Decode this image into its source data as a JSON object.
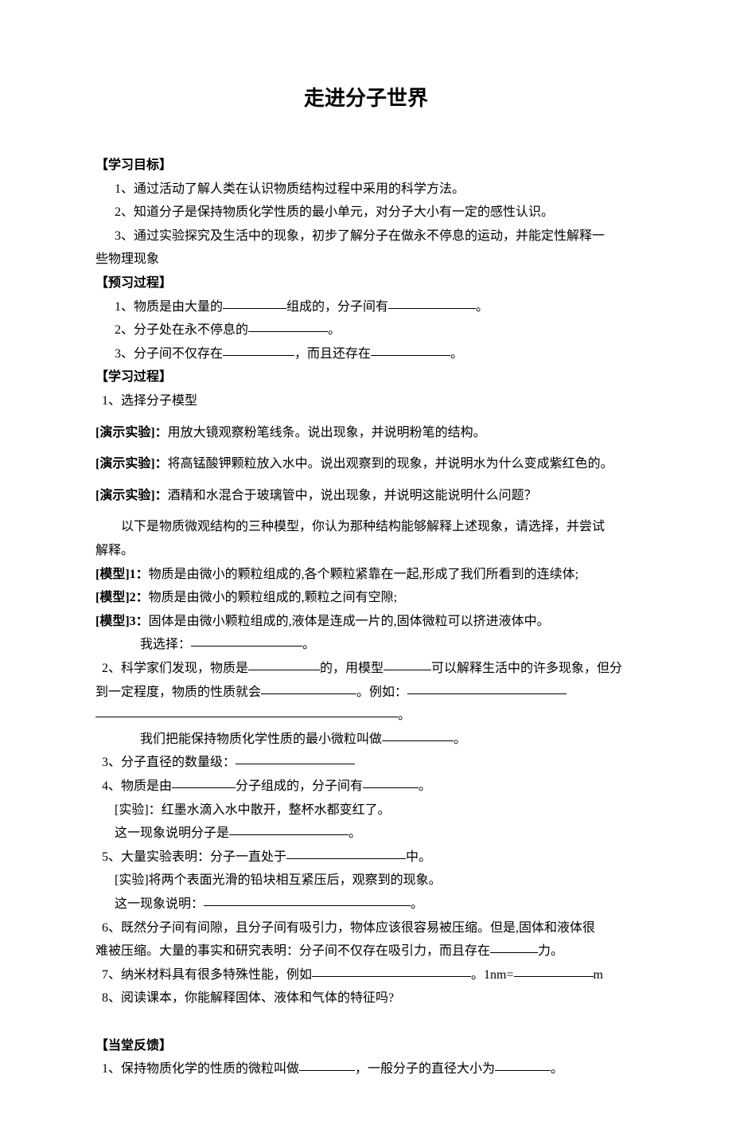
{
  "title": "走进分子世界",
  "s1": {
    "head": "【学习目标】",
    "i1": "1、通过活动了解人类在认识物质结构过程中采用的科学方法。",
    "i2": "2、知道分子是保持物质化学性质的最小单元，对分子大小有一定的感性认识。",
    "i3_a": "3、通过实验探究及生活中的现象，初步了解分子在做永不停息的运动，并能定性解释一",
    "i3_b": "些物理现象"
  },
  "s2": {
    "head": "【预习过程】",
    "i1_a": "1、物质是由大量的",
    "i1_b": "组成的，分子间有",
    "i1_c": "。",
    "i2_a": "2、分子处在永不停息的",
    "i2_b": "。",
    "i3_a": "3、分子间不仅存在",
    "i3_b": "，而且还存在",
    "i3_c": "。"
  },
  "s3": {
    "head": "【学习过程】",
    "i1": "1、选择分子模型",
    "e1_label": "[演示实验]：",
    "e1_text": "用放大镜观察粉笔线条。说出现象，并说明粉笔的结构。",
    "e2_label": "[演示实验]：",
    "e2_text": "将高锰酸钾颗粒放入水中。说出观察到的现象，并说明水为什么变成紫红色的。",
    "e3_label": "[演示实验]：",
    "e3_text": "酒精和水混合于玻璃管中，说出现象，并说明这能说明什么问题？",
    "p_intro_a": "以下是物质微观结构的三种模型，你认为那种结构能够解释上述现象，请选择，并尝试",
    "p_intro_b": "解释。",
    "m1_label": "[模型]1：",
    "m1_text": "物质是由微小的颗粒组成的,各个颗粒紧靠在一起,形成了我们所看到的连续体;",
    "m2_label": "[模型]2：",
    "m2_text": "物质是由微小的颗粒组成的,颗粒之间有空隙;",
    "m3_label": "[模型]3：",
    "m3_text": "固体是由微小颗粒组成的,液体是连成一片的,固体微粒可以挤进液体中。",
    "choose_a": "我选择：",
    "choose_b": "。",
    "q2_a": "2、科学家们发现，物质是",
    "q2_b": "的，用模型",
    "q2_c": "可以解释生活中的许多现象，但分",
    "q2_d": "到一定程度，物质的性质就会",
    "q2_e": "。例如：",
    "q2_f": "。",
    "q2_g_a": "我们把能保持物质化学性质的最小微粒叫做",
    "q2_g_b": "。",
    "q3_a": "3、分子直径的数量级：",
    "q4_a": "4、物质是由",
    "q4_b": "分子组成的，分子间有",
    "q4_c": "。",
    "exp4": "[实验]：红墨水滴入水中散开，整杯水都变红了。",
    "exp4_r_a": "这一现象说明分子是",
    "exp4_r_b": "。",
    "q5_a": "5、大量实验表明：分子一直处于",
    "q5_b": "中。",
    "exp5": "[实验]将两个表面光滑的铅块相互紧压后，观察到的现象。",
    "exp5_r_a": "这一现象说明：",
    "exp5_r_b": "。",
    "q6_a": "6、既然分子间有间隙，且分子间有吸引力，物体应该很容易被压缩。但是,固体和液体很",
    "q6_b": "难被压缩。大量的事实和研究表明：分子间不仅存在吸引力，而且存在",
    "q6_c": "力。",
    "q7_a": "7、纳米材料具有很多特殊性能，例如",
    "q7_b": "。1nm=",
    "q7_c": "m",
    "q8": "8、阅读课本，你能解释固体、液体和气体的特征吗?"
  },
  "s4": {
    "head": "【当堂反馈】",
    "i1_a": "1、保持物质化学的性质的微粒叫做",
    "i1_b": "，一般分子的直径大小为",
    "i1_c": "。"
  }
}
